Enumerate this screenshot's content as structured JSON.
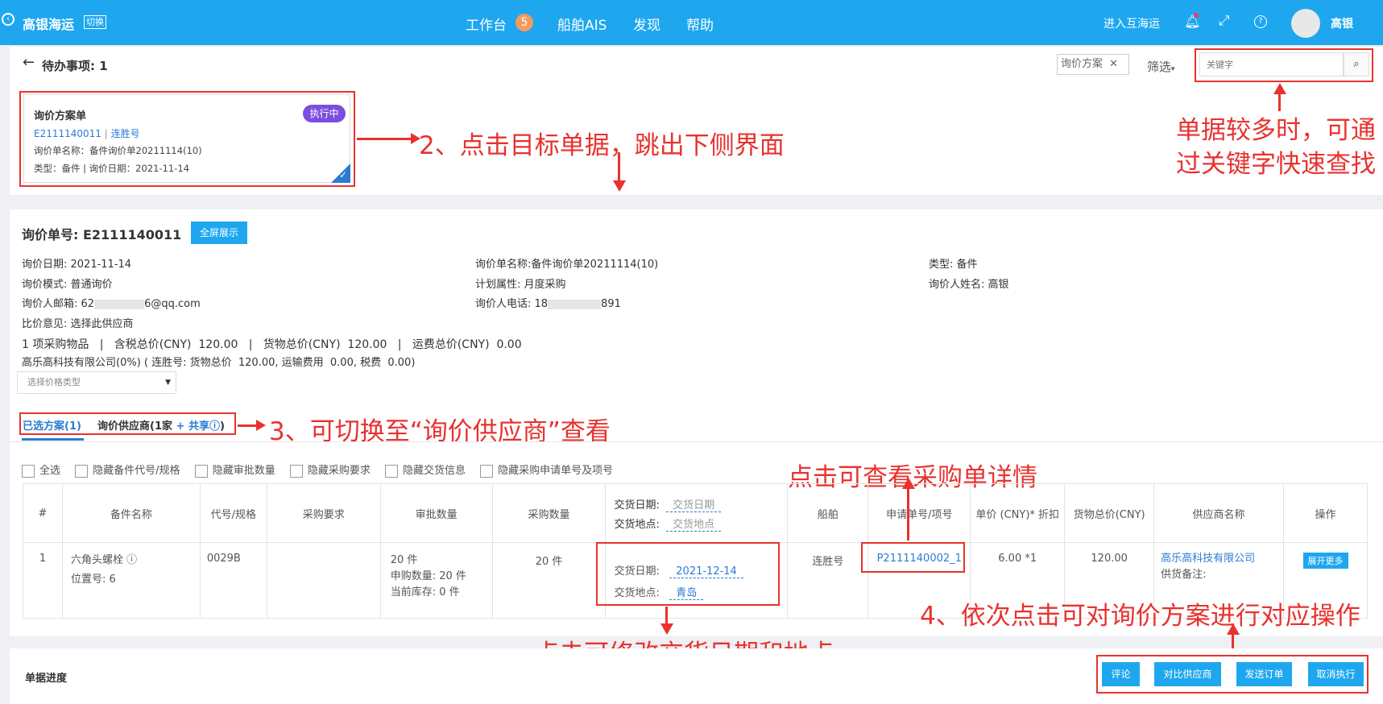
{
  "topbar": {
    "brand": "高银海运",
    "switch": "切换",
    "nav": [
      {
        "label": "工作台"
      },
      {
        "label": "船舶AIS"
      },
      {
        "label": "发现"
      },
      {
        "label": "帮助"
      }
    ],
    "badge": "5",
    "enter_label": "进入互海运",
    "user": "高银"
  },
  "todo": {
    "title": "待办事项: 1",
    "filter_tag": "询价方案",
    "filter_btn": "筛选",
    "search_placeholder": "关键字"
  },
  "card": {
    "title": "询价方案单",
    "status": "执行中",
    "number": "E2111140011",
    "ship": "连胜号",
    "name": "询价单名称：备件询价单20211114(10)",
    "meta": "类型：备件 | 询价日期：2021-11-14"
  },
  "annotations": {
    "a2": "2、点击目标单据，跳出下侧界面",
    "a_search": "单据较多时，可通过关键字快速查找",
    "a3": "3、可切换至“询价供应商”查看",
    "a_po": "点击可查看采购单详情",
    "a4": "4、依次点击可对询价方案进行对应操作",
    "a_delivery": "点击可修改交货日期和地点"
  },
  "detail": {
    "no_label": "询价单号:",
    "no": "E2111140011",
    "fullscreen": "全屏展示",
    "fields": {
      "date": "询价日期:  2021-11-14",
      "name": "询价单名称:备件询价单20211114(10)",
      "type": "类型: 备件",
      "mode": "询价模式: 普通询价",
      "plan": "计划属性: 月度采购",
      "person": "询价人姓名: 高银",
      "email": "询价人邮箱: 62",
      "email_tail": "6@qq.com",
      "phone": "询价人电话: 18",
      "phone_tail": "891",
      "opinion": "比价意见: 选择此供应商"
    },
    "summary": "1 项采购物品   |   含税总价(CNY)  120.00   |   货物总价(CNY)  120.00   |   运费总价(CNY)  0.00",
    "supplier_line": "高乐高科技有限公司(0%) ( 连胜号: 货物总价  120.00, 运输费用  0.00, 税费  0.00)",
    "price_type_placeholder": "选择价格类型"
  },
  "tabs": {
    "selected": "已选方案(1)",
    "supplier": "询价供应商(1家",
    "share": "+ 共享",
    "close": ")"
  },
  "checkboxes": [
    "全选",
    "隐藏备件代号/规格",
    "隐藏审批数量",
    "隐藏采购要求",
    "隐藏交货信息",
    "隐藏采购申请单号及项号"
  ],
  "table": {
    "headers": [
      "#",
      "备件名称",
      "代号/规格",
      "采购要求",
      "审批数量",
      "采购数量",
      "",
      "船舶",
      "申请单号/项号",
      "单价 (CNY)* 折扣",
      "货物总价(CNY)",
      "供应商名称",
      "操作"
    ],
    "delivery_head": {
      "date_label": "交货日期:",
      "date_ph": "交货日期",
      "place_label": "交货地点:",
      "place_ph": "交货地点"
    },
    "row": {
      "idx": "1",
      "part": "六角头螺栓 ⓘ",
      "position": "位置号:  6",
      "code": "0029B",
      "req": "",
      "approve1": "20 件",
      "approve2": "申购数量:  20 件",
      "approve3": "当前库存:  0 件",
      "purchase": "20 件",
      "date_label": "交货日期:",
      "date": "2021-12-14",
      "place_label": "交货地点:",
      "place": "青岛",
      "ship": "连胜号",
      "po": "P2111140002_1",
      "price": "6.00 *1",
      "total": "120.00",
      "supplier": "高乐高科技有限公司",
      "supplier_note": "供货备注:",
      "action": "展开更多"
    }
  },
  "progress_title": "单据进度",
  "actions": [
    "评论",
    "对比供应商",
    "发送订单",
    "取消执行"
  ],
  "colors": {
    "primary": "#1ea7ef",
    "annotation": "#e8322f",
    "link": "#2a7bd5",
    "status": "#7a4fe0"
  }
}
